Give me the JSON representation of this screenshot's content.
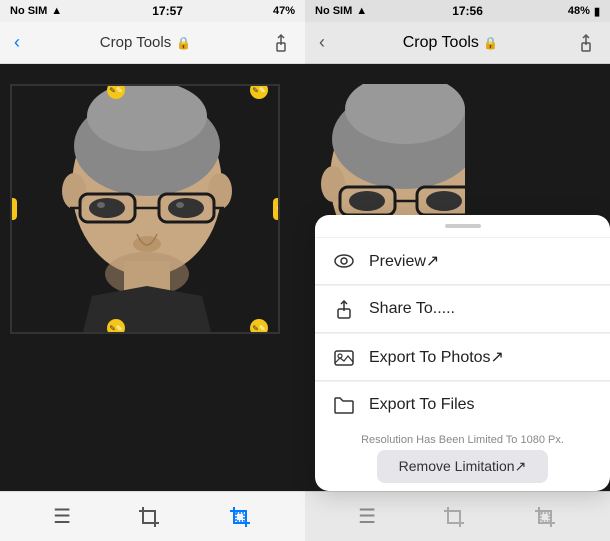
{
  "left": {
    "statusBar": {
      "carrier": "No SIM",
      "wifi": "wifi",
      "time": "17:57",
      "battery": "47%",
      "noSim2": "No SIM",
      "wifi2": "wifi"
    },
    "toolbar": {
      "title": "Crop Tools",
      "lockIcon": "🔒"
    },
    "bottomNav": {
      "menuIcon": "☰",
      "cropIcon": "crop",
      "activeCropIcon": "crop-active"
    }
  },
  "right": {
    "statusBar": {
      "time": "17:56",
      "battery": "48%"
    },
    "toolbar": {
      "title": "Crop Tools",
      "lockIcon": "🔒"
    },
    "actionSheet": {
      "handle": "",
      "items": [
        {
          "id": "preview",
          "label": "Preview↗",
          "icon": "eye"
        },
        {
          "id": "share",
          "label": "Share To.....",
          "icon": "share"
        },
        {
          "id": "export-photos",
          "label": "Export To Photos↗",
          "icon": "photo"
        },
        {
          "id": "export-files",
          "label": "Export To Files",
          "icon": "folder"
        }
      ],
      "resolutionText": "Resolution Has Been Limited To 1080 Px.",
      "removeButton": "Remove Limitation↗"
    }
  }
}
